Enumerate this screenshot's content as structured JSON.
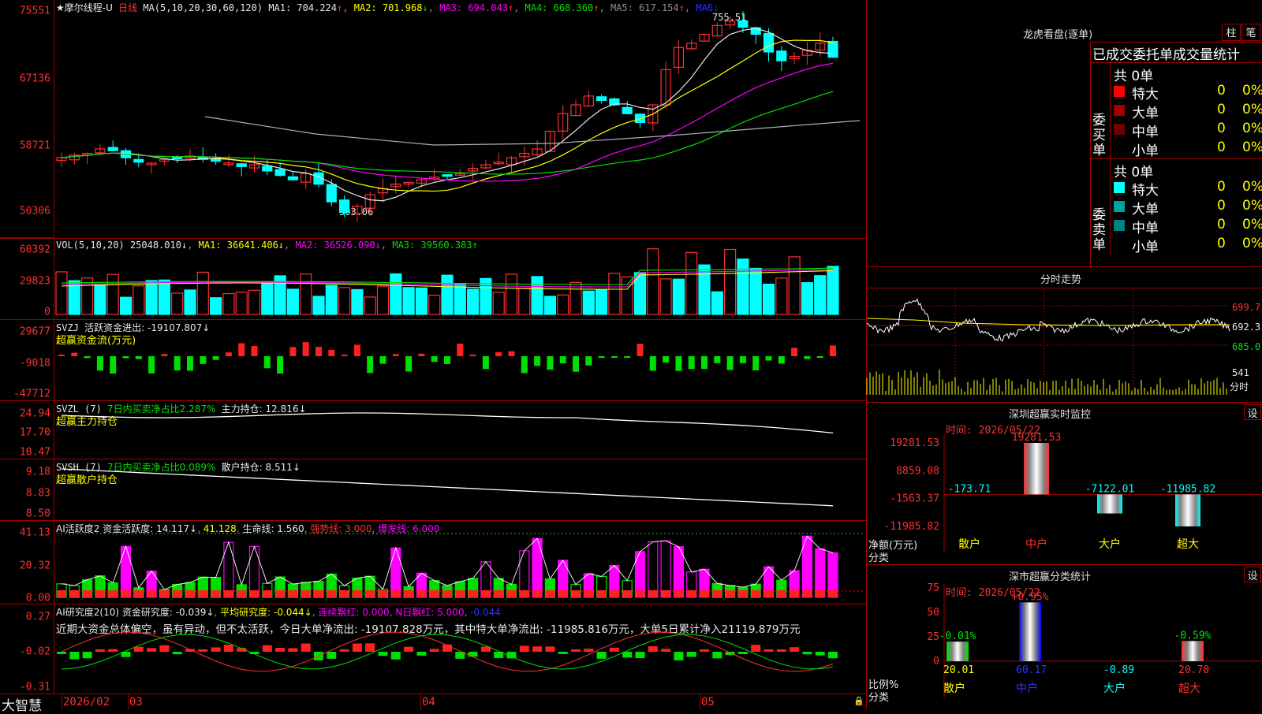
{
  "main": {
    "title": "★摩尔线程-U",
    "period": "日线",
    "ma_spec": "MA(5,10,20,30,60,120)",
    "ma": [
      {
        "label": "MA1: 704.224",
        "arrow": "↑",
        "color": "#e8e8e8"
      },
      {
        "label": "MA2: 701.968",
        "arrow": "↓",
        "color": "#ffff00"
      },
      {
        "label": "MA3: 694.043",
        "arrow": "↑",
        "color": "#ff00ff"
      },
      {
        "label": "MA4: 668.360",
        "arrow": "↑",
        "color": "#00e000"
      },
      {
        "label": "MA5: 617.154",
        "arrow": "↑",
        "color": "#b0b0b0"
      },
      {
        "label": "MA6:",
        "arrow": "",
        "color": "#0000ff"
      }
    ],
    "yticks": [
      "75551",
      "67136",
      "58721",
      "50306"
    ],
    "high_label": "755.51",
    "low_label": "503.06"
  },
  "vol": {
    "header": "VOL(5,10,20)",
    "value": "25048.010↓",
    "ma1": "MA1: 36641.406↓",
    "ma2": "MA2: 36526.090↓",
    "ma3": "MA3: 39560.383↑",
    "yticks": [
      "60392",
      "29823",
      "0"
    ]
  },
  "svzj": {
    "header": "SVZJ",
    "value": "活跃资金进出: -19107.807↓",
    "sub": "超赢资金流(万元)",
    "yticks": [
      "29677",
      "-9018",
      "-47712"
    ]
  },
  "svzl": {
    "header": "SVZL (7)",
    "ratio": "7日内买卖净占比2.287%",
    "value": "主力持仓: 12.816↓",
    "sub": "超赢主力持仓",
    "yticks": [
      "24.94",
      "17.70",
      "10.47"
    ]
  },
  "svsh": {
    "header": "SVSH (7)",
    "ratio": "7日内买卖净占比0.089%",
    "value": "散户持仓: 8.511↓",
    "sub": "超赢散户持仓",
    "yticks": [
      "9.18",
      "8.83",
      "8.50"
    ]
  },
  "ai1": {
    "header": "AI活跃度2",
    "v1": "资金活跃度: 14.117↓",
    "v2": "41.128",
    "v3": "生命线: 1.560",
    "v4": "强势线: 3.000",
    "v5": "爆发线: 6.000",
    "yticks": [
      "41.13",
      "20.32",
      "0.00"
    ]
  },
  "ai2": {
    "header": "AI研究度2(10)",
    "v1": "资金研究度: -0.039↓",
    "v2": "平均研究度: -0.044↓",
    "v3": "连续飘红: 0.000",
    "v4": "N日飘红: 5.000",
    "v5": "-0.044",
    "note": "近期大资金总体偏空，虽有异动，但不太活跃，今日大单净流出: -19107.828万元，其中特大单净流出: -11985.816万元，大单5日累计净入21119.879万元",
    "yticks": [
      "0.27",
      "-0.02",
      "-0.31"
    ]
  },
  "bottom_axis": {
    "brand": "大智慧",
    "labels": [
      "2026/02",
      "03",
      "04",
      "05"
    ]
  },
  "right": {
    "lhb_title": "龙虎看盘(逐单)",
    "btn_zhu": "柱",
    "btn_bi": "笔",
    "stat_title": "已成交委托单成交量统计",
    "buy_label": "委买单",
    "sell_label": "委卖单",
    "buy_total": "共 0单",
    "sell_total": "共 0单",
    "buy_rows": [
      {
        "name": "特大",
        "val": "0",
        "pct": "0%",
        "color": "#ff0000"
      },
      {
        "name": "大单",
        "val": "0",
        "pct": "0%",
        "color": "#a00000"
      },
      {
        "name": "中单",
        "val": "0",
        "pct": "0%",
        "color": "#700000"
      },
      {
        "name": "小单",
        "val": "0",
        "pct": "0%",
        "color": ""
      }
    ],
    "sell_rows": [
      {
        "name": "特大",
        "val": "0",
        "pct": "0%",
        "color": "#00ffff"
      },
      {
        "name": "大单",
        "val": "0",
        "pct": "0%",
        "color": "#00a0a0"
      },
      {
        "name": "中单",
        "val": "0",
        "pct": "0%",
        "color": "#008080"
      },
      {
        "name": "小单",
        "val": "0",
        "pct": "0%",
        "color": ""
      }
    ],
    "fs_title": "分时走势",
    "fs_yticks": [
      "699.7",
      "692.3",
      "685.0"
    ],
    "fs_vol": "541",
    "fs_vol_unit": "分时",
    "sz_title": "深圳超赢实时监控",
    "sz_btn": "设",
    "sz_time": "时间: 2026/05/22",
    "sz_yticks": [
      "19281.53",
      "8859.08",
      "-1563.37",
      "-11985.82"
    ],
    "sz_ylabel": "净额(万元)",
    "sz_xlabel": "分类",
    "sz_cats": [
      "散户",
      "中户",
      "大户",
      "超大"
    ],
    "sz_values": [
      -173.71,
      19281.53,
      -7122.01,
      -11985.82
    ],
    "sz_value_labels": [
      "-173.71",
      "19281.53",
      "-7122.01",
      "-11985.82"
    ],
    "cls_title": "深市超赢分类统计",
    "cls_btn": "设",
    "cls_time": "时间: 2026/05/22",
    "cls_yticks": [
      "75",
      "50",
      "25",
      "0"
    ],
    "cls_ylabel": "比例%",
    "cls_xlabel": "分类",
    "cls_cats": [
      "散户",
      "中户",
      "大户",
      "超大"
    ],
    "cls_values": [
      20.01,
      60.17,
      -0.89,
      20.7
    ],
    "cls_value_labels": [
      "20.01",
      "60.17",
      "-0.89",
      "20.70"
    ],
    "cls_top_labels": [
      "-0.01%",
      "+0.95%",
      "",
      "-0.59%"
    ]
  },
  "chart_data": {
    "type": "bar",
    "title": "深圳超赢实时监控",
    "categories": [
      "散户",
      "中户",
      "大户",
      "超大"
    ],
    "series": [
      {
        "name": "净额(万元)",
        "values": [
          -173.71,
          19281.53,
          -7122.01,
          -11985.82
        ]
      }
    ],
    "ylim": [
      -11985.82,
      19281.53
    ]
  }
}
